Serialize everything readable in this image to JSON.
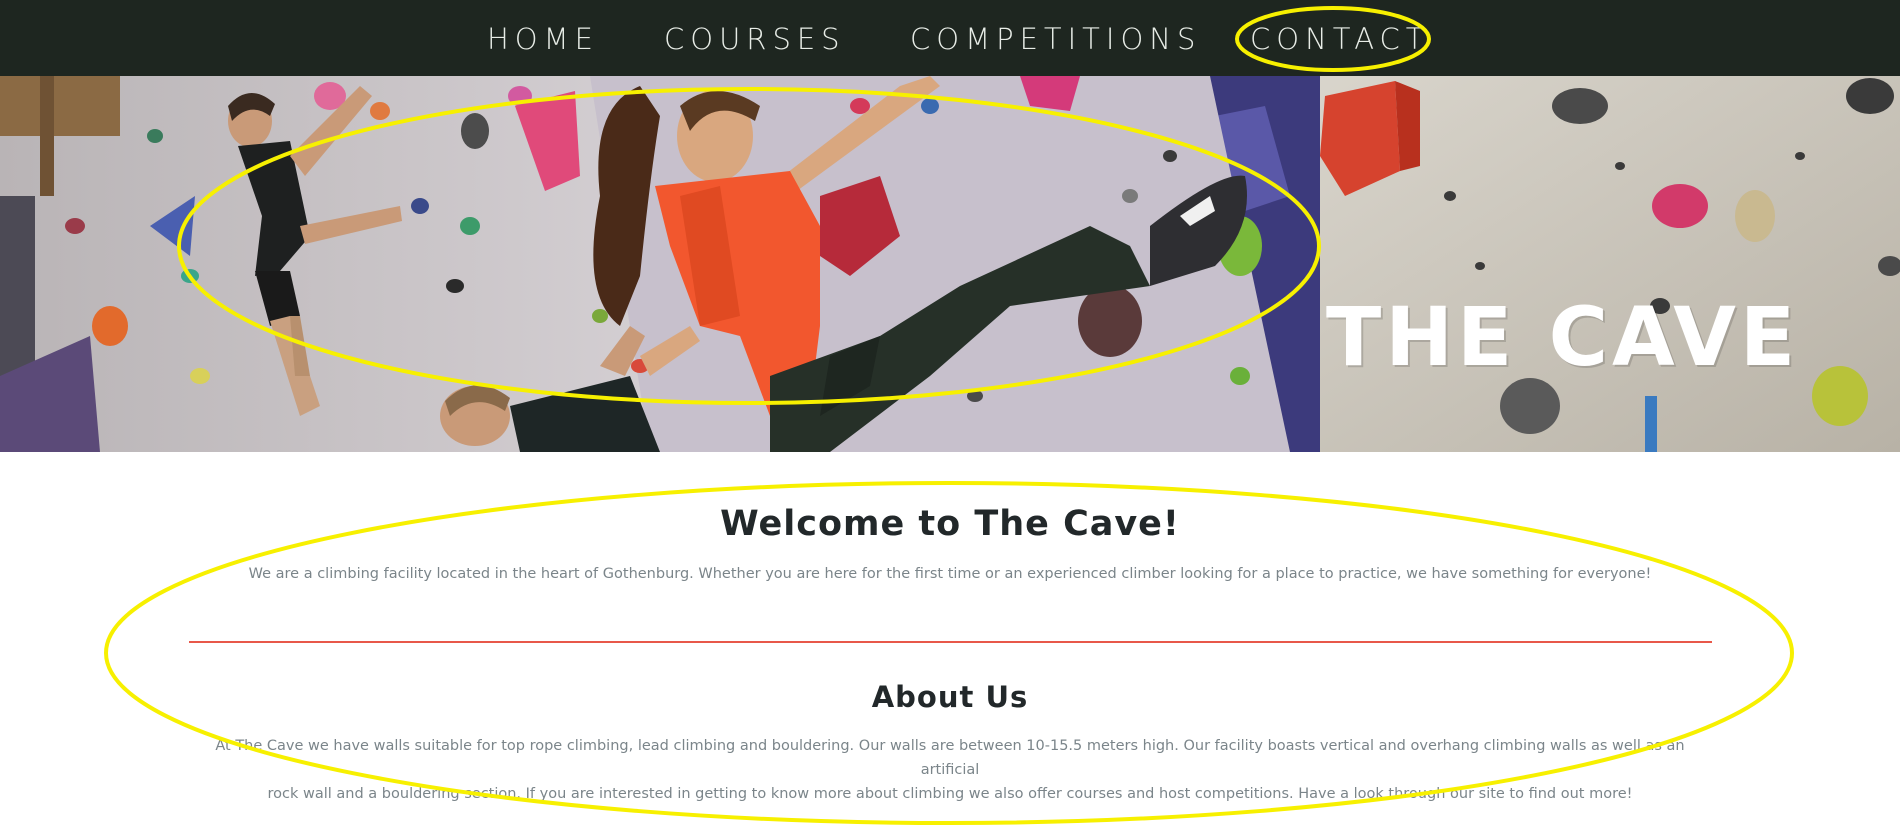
{
  "nav": {
    "items": [
      {
        "label": "HOME"
      },
      {
        "label": "COURSES"
      },
      {
        "label": "COMPETITIONS"
      },
      {
        "label": "CONTACT"
      }
    ]
  },
  "hero": {
    "title": "THE CAVE"
  },
  "welcome": {
    "title": "Welcome to The Cave!",
    "text": "We are a climbing facility located in the heart of Gothenburg. Whether you are here for the first time or an experienced climber looking for a place to practice, we have something for everyone!"
  },
  "about": {
    "title": "About Us",
    "text_line1": "At The Cave we have walls suitable for top rope climbing, lead climbing and bouldering. Our walls are between 10-15.5 meters high. Our facility boasts vertical and overhang climbing walls as well as an artificial",
    "text_line2": "rock wall and a bouldering section. If you are interested in getting to know more about climbing we also offer courses and host competitions. Have a look through our site to find out more!"
  },
  "colors": {
    "nav_bg": "#1e2620",
    "nav_text": "#e7ece6",
    "heading": "#22282a",
    "body_text": "#7b858a",
    "divider": "#e8584a",
    "annotation": "#f7f000"
  }
}
